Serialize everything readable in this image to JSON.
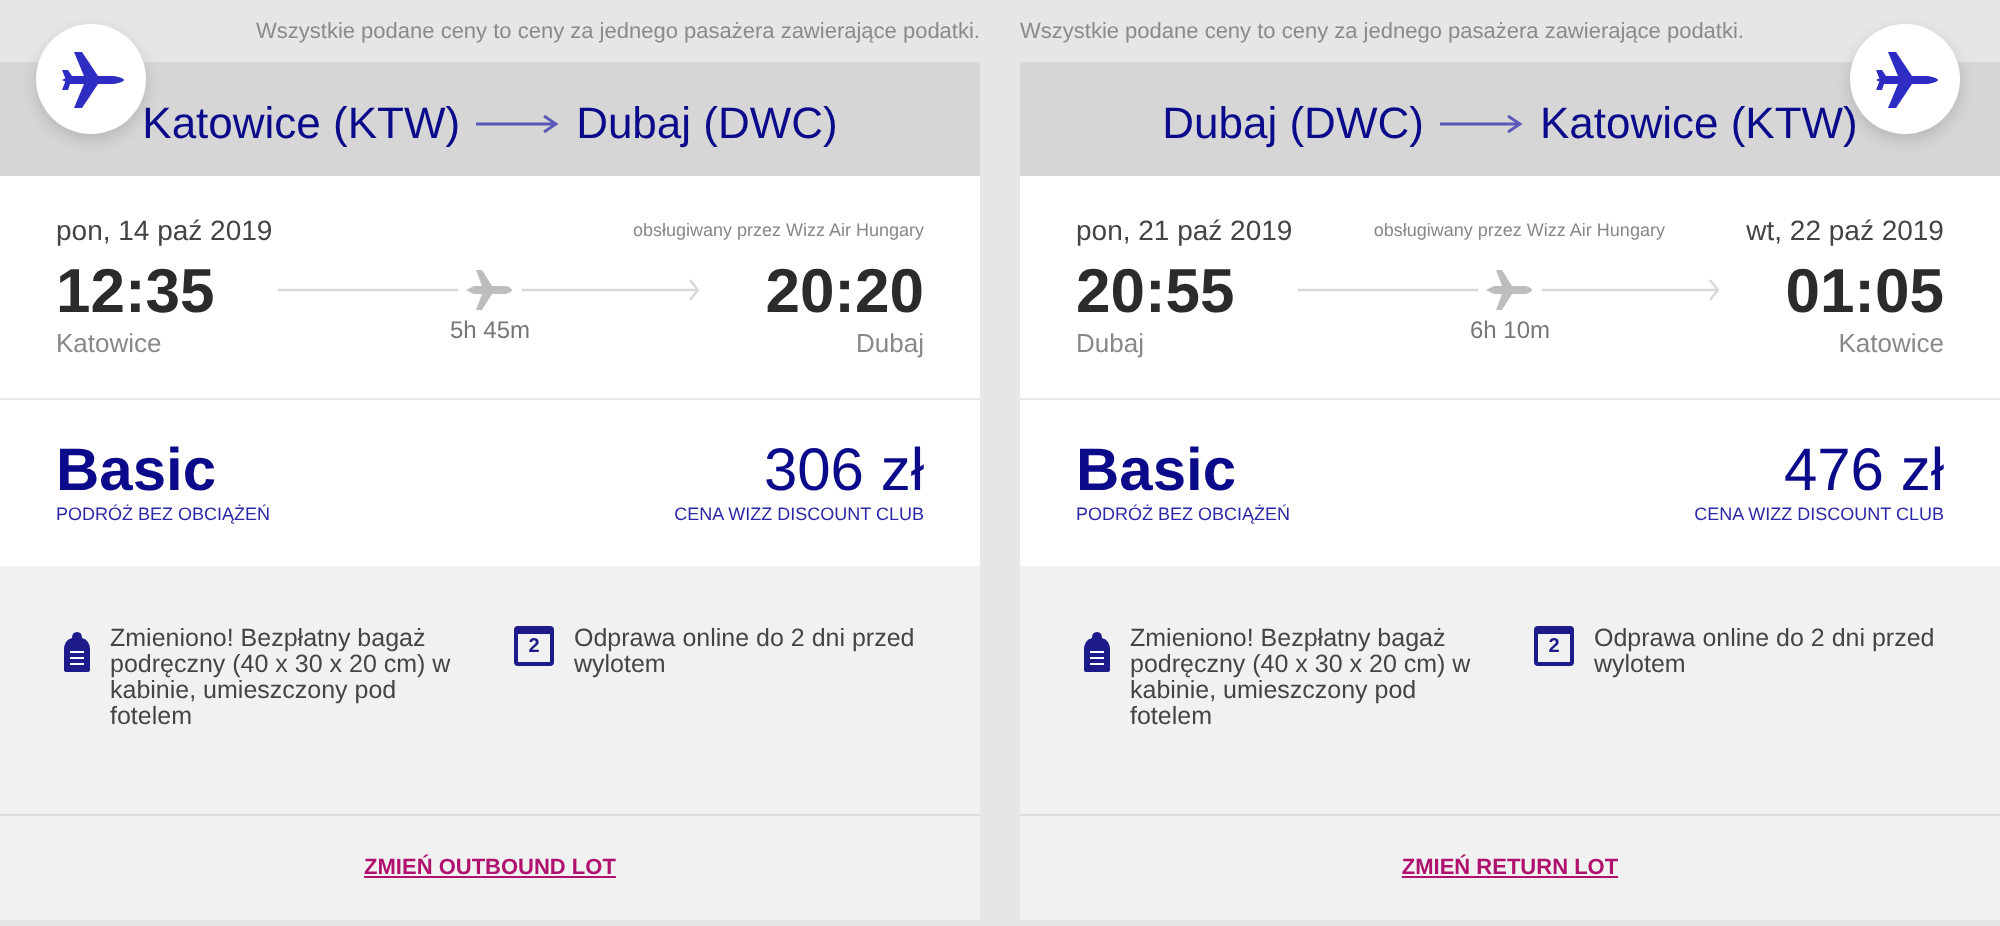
{
  "flights": [
    {
      "badge_right": false,
      "disclaimer": "Wszystkie podane ceny to ceny za jednego pasażera zawierające podatki.",
      "route": {
        "from": "Katowice (KTW)",
        "to": "Dubaj (DWC)"
      },
      "departure_date": "pon, 14 paź 2019",
      "operator": "obsługiwany przez Wizz Air Hungary",
      "departure_time": "12:35",
      "arrival_time": "20:20",
      "departure_city": "Katowice",
      "arrival_city": "Dubaj",
      "duration": "5h 45m",
      "fare_name": "Basic",
      "fare_subtitle": "PODRÓŻ BEZ OBCIĄŻEŃ",
      "price": "306 zł",
      "price_note": "CENA WIZZ DISCOUNT CLUB",
      "features": [
        {
          "kind": "bag",
          "text": "Zmieniono! Bezpłatny bagaż podręczny (40 x 30 x 20 cm) w kabinie, umieszczony pod fotelem"
        },
        {
          "kind": "calendar",
          "icon_label": "2",
          "text": "Odprawa online do 2 dni przed wylotem"
        }
      ],
      "change_link": "ZMIEŃ OUTBOUND LOT"
    },
    {
      "badge_right": true,
      "disclaimer": "Wszystkie podane ceny to ceny za jednego pasażera zawierające podatki.",
      "route": {
        "from": "Dubaj (DWC)",
        "to": "Katowice (KTW)"
      },
      "departure_date": "pon, 21 paź 2019",
      "arrival_date": "wt, 22 paź 2019",
      "operator": "obsługiwany przez Wizz Air Hungary",
      "departure_time": "20:55",
      "arrival_time": "01:05",
      "departure_city": "Dubaj",
      "arrival_city": "Katowice",
      "duration": "6h 10m",
      "fare_name": "Basic",
      "fare_subtitle": "PODRÓŻ BEZ OBCIĄŻEŃ",
      "price": "476 zł",
      "price_note": "CENA WIZZ DISCOUNT CLUB",
      "features": [
        {
          "kind": "bag",
          "text": "Zmieniono! Bezpłatny bagaż podręczny (40 x 30 x 20 cm) w kabinie, umieszczony pod fotelem"
        },
        {
          "kind": "calendar",
          "icon_label": "2",
          "text": "Odprawa online do 2 dni przed wylotem"
        }
      ],
      "change_link": "ZMIEŃ RETURN LOT"
    }
  ]
}
